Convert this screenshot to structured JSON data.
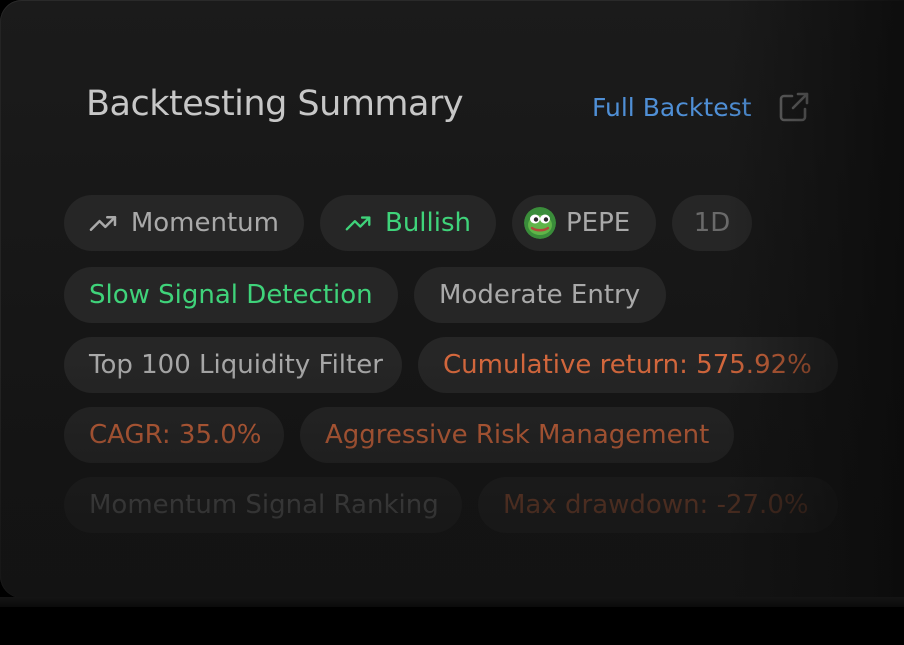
{
  "card": {
    "title": "Backtesting Summary",
    "full_backtest_label": "Full Backtest"
  },
  "tags": {
    "momentum": "Momentum",
    "bullish": "Bullish",
    "pepe": "PEPE",
    "timeframe": "1D",
    "slow_signal": "Slow Signal Detection",
    "moderate_entry": "Moderate Entry",
    "liquidity_filter": "Top 100 Liquidity Filter",
    "cumulative_return": "Cumulative return: 575.92%",
    "cagr": "CAGR: 35.0%",
    "risk_management": "Aggressive Risk Management",
    "signal_ranking": "Momentum Signal Ranking",
    "max_drawdown": "Max drawdown: -27.0%"
  },
  "icons": {
    "momentum": "trending-up-icon",
    "bullish": "trending-up-icon",
    "pepe": "pepe-token-icon",
    "full_backtest": "external-link-icon"
  },
  "colors": {
    "positive": "#3fd37a",
    "metric": "#d5683d",
    "link": "#4f8fd6",
    "chip_bg": "#262626"
  }
}
